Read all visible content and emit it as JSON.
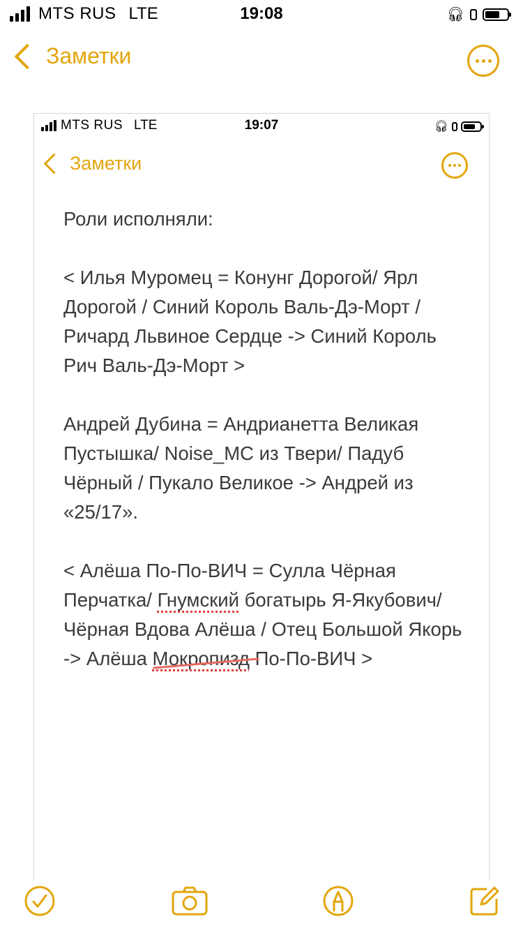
{
  "status_bar": {
    "carrier": "MTS RUS",
    "network": "LTE",
    "time": "19:08"
  },
  "nav": {
    "back_label": "Заметки",
    "more_icon": "ellipsis-circle-icon"
  },
  "embedded_screenshot": {
    "status_bar": {
      "carrier": "MTS RUS",
      "network": "LTE",
      "time": "19:07"
    },
    "nav": {
      "back_label": "Заметки"
    },
    "note": {
      "title": "Роли исполняли:",
      "p1": "< Илья Муромец = Конунг Дорогой/ Ярл Дорогой / Синий Король Валь-Дэ-Морт / Ричард Львиное Сердце -> Синий Король Рич Валь-Дэ-Морт >",
      "p2": "Андрей Дубина = Андрианетта Великая Пустышка/ Noise_MC из Твери/ Падуб Чёрный / Пукало Великое -> Андрей из «25/17».",
      "p3_a": "< Алёша По-По-ВИЧ = Сулла Чёрная Перчатка/ ",
      "p3_b": "Гнумский",
      "p3_c": " богатырь Я-Якубович/ Чёрная Вдова Алёша / Отец Большой Якорь -> Алёша ",
      "p3_d": "Мокропизд",
      "p3_e": " По-По-ВИЧ >"
    }
  },
  "toolbar": {
    "items": [
      "checklist-icon",
      "camera-icon",
      "markup-pen-icon",
      "compose-icon"
    ]
  },
  "colors": {
    "accent": "#e2a60c",
    "text": "#3a3a3a",
    "spell_error": "#e23b3b"
  }
}
